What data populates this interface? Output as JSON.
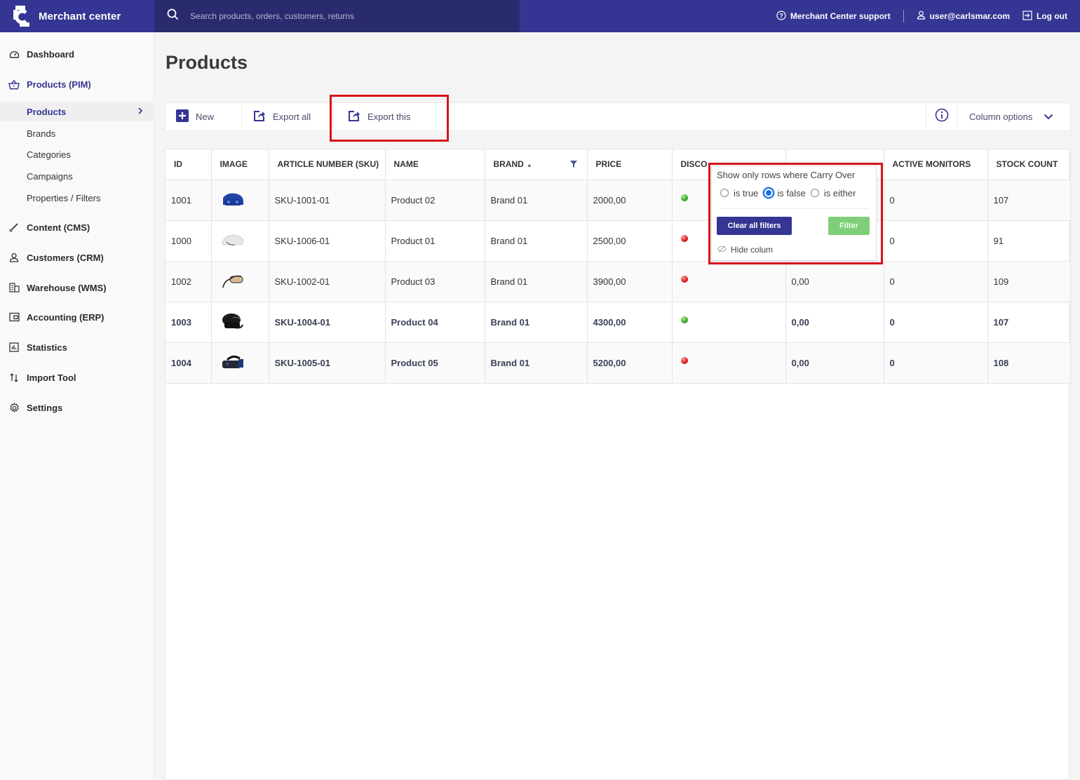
{
  "header": {
    "app_name": "Merchant center",
    "search_placeholder": "Search products, orders, customers, returns",
    "support_label": "Merchant Center support",
    "user_email": "user@carlsmar.com",
    "logout_label": "Log out"
  },
  "sidebar": {
    "items": [
      {
        "label": "Dashboard",
        "icon": "gauge-icon"
      },
      {
        "label": "Products (PIM)",
        "icon": "basket-icon",
        "active": true
      },
      {
        "label": "Content (CMS)",
        "icon": "brush-icon"
      },
      {
        "label": "Customers (CRM)",
        "icon": "user-icon"
      },
      {
        "label": "Warehouse (WMS)",
        "icon": "building-icon"
      },
      {
        "label": "Accounting (ERP)",
        "icon": "wallet-icon"
      },
      {
        "label": "Statistics",
        "icon": "chart-icon"
      },
      {
        "label": "Import Tool",
        "icon": "arrows-updown-icon"
      },
      {
        "label": "Settings",
        "icon": "gear-icon"
      }
    ],
    "sub_items": [
      {
        "label": "Products",
        "active": true
      },
      {
        "label": "Brands"
      },
      {
        "label": "Categories"
      },
      {
        "label": "Campaigns"
      },
      {
        "label": "Properties / Filters"
      }
    ]
  },
  "page": {
    "title": "Products"
  },
  "toolbar": {
    "new_label": "New",
    "export_all_label": "Export all",
    "export_this_label": "Export this",
    "column_options_label": "Column options"
  },
  "table": {
    "columns": [
      "ID",
      "IMAGE",
      "ARTICLE NUMBER (SKU)",
      "NAME",
      "BRAND",
      "PRICE",
      "DISCO",
      "",
      "ACTIVE MONITORS",
      "STOCK COUNT"
    ],
    "sort": {
      "column": "BRAND",
      "direction": "ascending"
    },
    "rows": [
      {
        "id": "1001",
        "image": "blue-vr-headset",
        "sku": "SKU-1001-01",
        "name": "Product 02",
        "brand": "Brand 01",
        "price": "2000,00",
        "status": "green",
        "col8": "",
        "active_monitors": "0",
        "stock": "107"
      },
      {
        "id": "1000",
        "image": "white-vr-headset",
        "sku": "SKU-1006-01",
        "name": "Product 01",
        "brand": "Brand 01",
        "price": "2500,00",
        "status": "red",
        "col8": "",
        "active_monitors": "0",
        "stock": "91"
      },
      {
        "id": "1002",
        "image": "beige-vr-headset",
        "sku": "SKU-1002-01",
        "name": "Product 03",
        "brand": "Brand 01",
        "price": "3900,00",
        "status": "red",
        "col8": "0,00",
        "active_monitors": "0",
        "stock": "109"
      },
      {
        "id": "1003",
        "image": "black-vr-headset",
        "sku": "SKU-1004-01",
        "name": "Product 04",
        "brand": "Brand 01",
        "price": "4300,00",
        "status": "green",
        "col8": "0,00",
        "active_monitors": "0",
        "stock": "107"
      },
      {
        "id": "1004",
        "image": "dark-vr-headset",
        "sku": "SKU-1005-01",
        "name": "Product 05",
        "brand": "Brand 01",
        "price": "5200,00",
        "status": "red",
        "col8": "0,00",
        "active_monitors": "0",
        "stock": "108"
      }
    ]
  },
  "filter_popup": {
    "title": "Show only rows where Carry Over",
    "options": [
      "is true",
      "is false",
      "is either"
    ],
    "selected": "is false",
    "clear_label": "Clear all filters",
    "filter_label": "Filter",
    "hide_label": "Hide colum"
  },
  "colors": {
    "brand": "#353593",
    "search_bg": "#2a2a6f",
    "highlight": "#d7141b",
    "status_green": "#3aa52a",
    "status_red": "#d71d1d",
    "filter_button": "#7fcf7a"
  }
}
